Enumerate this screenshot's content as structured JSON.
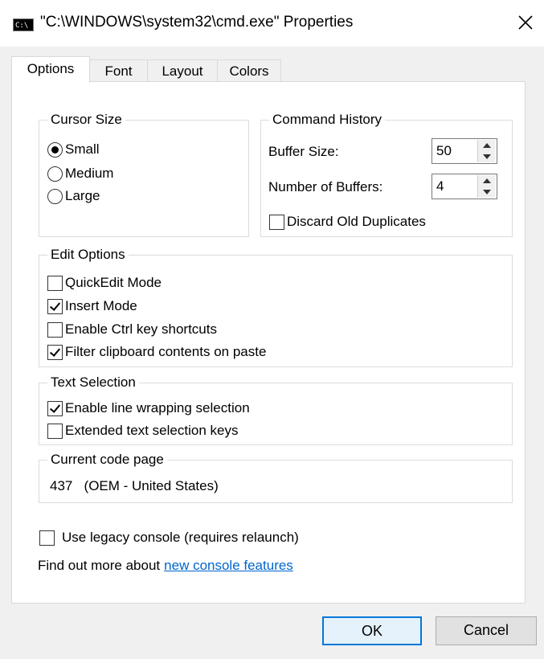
{
  "window": {
    "title": "\"C:\\WINDOWS\\system32\\cmd.exe\" Properties",
    "icon_text": "C:\\"
  },
  "tabs": [
    {
      "label": "Options",
      "active": true
    },
    {
      "label": "Font",
      "active": false
    },
    {
      "label": "Layout",
      "active": false
    },
    {
      "label": "Colors",
      "active": false
    }
  ],
  "cursor_size": {
    "title": "Cursor Size",
    "options": [
      {
        "label": "Small",
        "selected": true
      },
      {
        "label": "Medium",
        "selected": false
      },
      {
        "label": "Large",
        "selected": false
      }
    ]
  },
  "command_history": {
    "title": "Command History",
    "buffer_size_label": "Buffer Size:",
    "buffer_size_value": "50",
    "num_buffers_label": "Number of Buffers:",
    "num_buffers_value": "4",
    "discard_label": "Discard Old Duplicates",
    "discard_checked": false
  },
  "edit_options": {
    "title": "Edit Options",
    "items": [
      {
        "label": "QuickEdit Mode",
        "checked": false
      },
      {
        "label": "Insert Mode",
        "checked": true
      },
      {
        "label": "Enable Ctrl key shortcuts",
        "checked": false
      },
      {
        "label": "Filter clipboard contents on paste",
        "checked": true
      }
    ]
  },
  "text_selection": {
    "title": "Text Selection",
    "items": [
      {
        "label": "Enable line wrapping selection",
        "checked": true
      },
      {
        "label": "Extended text selection keys",
        "checked": false
      }
    ]
  },
  "code_page": {
    "title": "Current code page",
    "value": "437   (OEM - United States)"
  },
  "legacy": {
    "label": "Use legacy console (requires relaunch)",
    "checked": false
  },
  "find_out": {
    "text": "Find out more about",
    "link": "new console features"
  },
  "buttons": {
    "ok": "OK",
    "cancel": "Cancel"
  },
  "colors": {
    "link": "#0066cc",
    "accent": "#0078d7"
  }
}
